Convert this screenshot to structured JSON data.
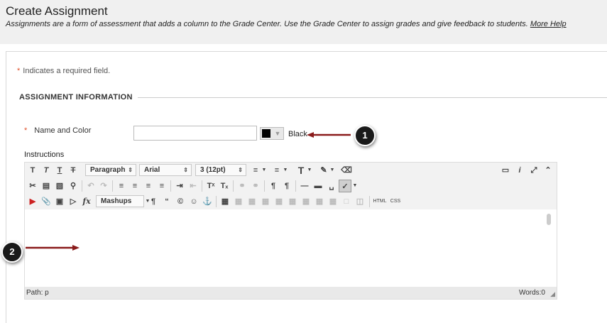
{
  "header": {
    "title": "Create Assignment",
    "subtitle": "Assignments are a form of assessment that adds a column to the Grade Center. Use the Grade Center to assign grades and give feedback to students.",
    "help_link": "More Help"
  },
  "form": {
    "required_note": "Indicates a required field.",
    "required_marker": "*",
    "section_title": "ASSIGNMENT INFORMATION",
    "name_label": "Name and Color",
    "name_value": "",
    "color_value": "#000000",
    "color_name": "Black",
    "instructions_label": "Instructions"
  },
  "editor": {
    "row1": {
      "bold": "T",
      "italic": "T",
      "underline": "T",
      "strike": "T",
      "format_select": "Paragraph",
      "font_select": "Arial",
      "size_select": "3 (12pt)"
    },
    "row3": {
      "mashups": "Mashups",
      "html": "HTML",
      "css": "CSS"
    },
    "status": {
      "path": "Path: p",
      "words": "Words:0"
    }
  },
  "callouts": {
    "badge1": "1",
    "badge2": "2"
  }
}
